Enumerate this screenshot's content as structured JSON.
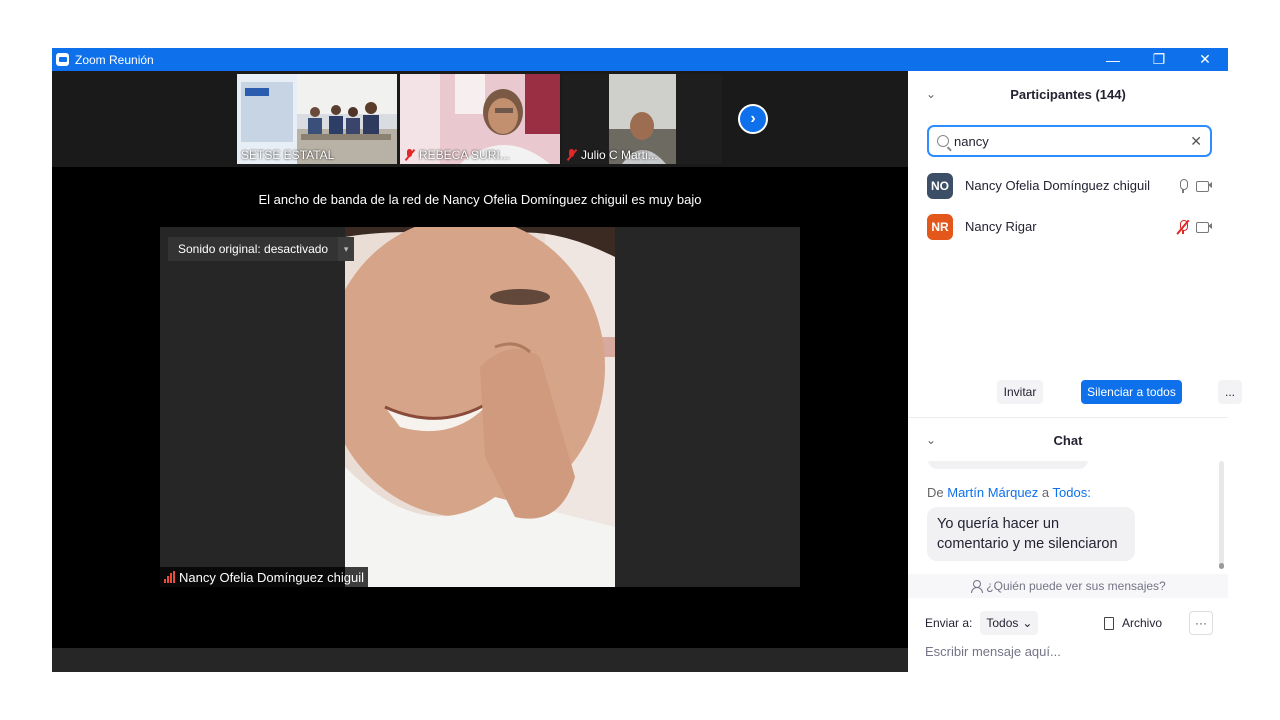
{
  "window": {
    "title": "Zoom Reunión",
    "minimize": "—",
    "restore": "❐",
    "close": "✕"
  },
  "strip": {
    "thumbs": [
      {
        "name": "SETSE ESTATAL",
        "muted": false
      },
      {
        "name": "REBECA SURI...",
        "muted": true
      },
      {
        "name": "Julio C Marti...",
        "muted": true
      }
    ],
    "next_icon": "›"
  },
  "stage": {
    "notice": "El ancho de banda de la red de Nancy Ofelia Domínguez chiguil es muy bajo",
    "audio_badge": "Sonido original: desactivado",
    "audio_caret": "▾",
    "speaker_name": "Nancy Ofelia Domínguez chiguil"
  },
  "participants": {
    "title": "Participantes (144)",
    "search_value": "nancy",
    "clear_icon": "✕",
    "items": [
      {
        "initials": "NO",
        "name": "Nancy Ofelia Domínguez chiguil",
        "color": "#3d4f66",
        "mic_muted": false
      },
      {
        "initials": "NR",
        "name": "Nancy Rigar",
        "color": "#e4571a",
        "mic_muted": true
      }
    ],
    "invite": "Invitar",
    "mute_all": "Silenciar a todos",
    "more": "..."
  },
  "chat": {
    "title": "Chat",
    "from_prefix": "De",
    "sender": "Martín Márquez",
    "to_word": "a",
    "recipient": "Todos:",
    "message": "Yo quería hacer un comentario y me silenciaron",
    "who_sees": "¿Quién puede ver sus mensajes?",
    "send_to_label": "Enviar a:",
    "send_to_value": "Todos",
    "dropdown_icon": "⌄",
    "file_label": "Archivo",
    "more_icon": "···",
    "input_placeholder": "Escribir mensaje aquí..."
  },
  "chevron": "⌄"
}
